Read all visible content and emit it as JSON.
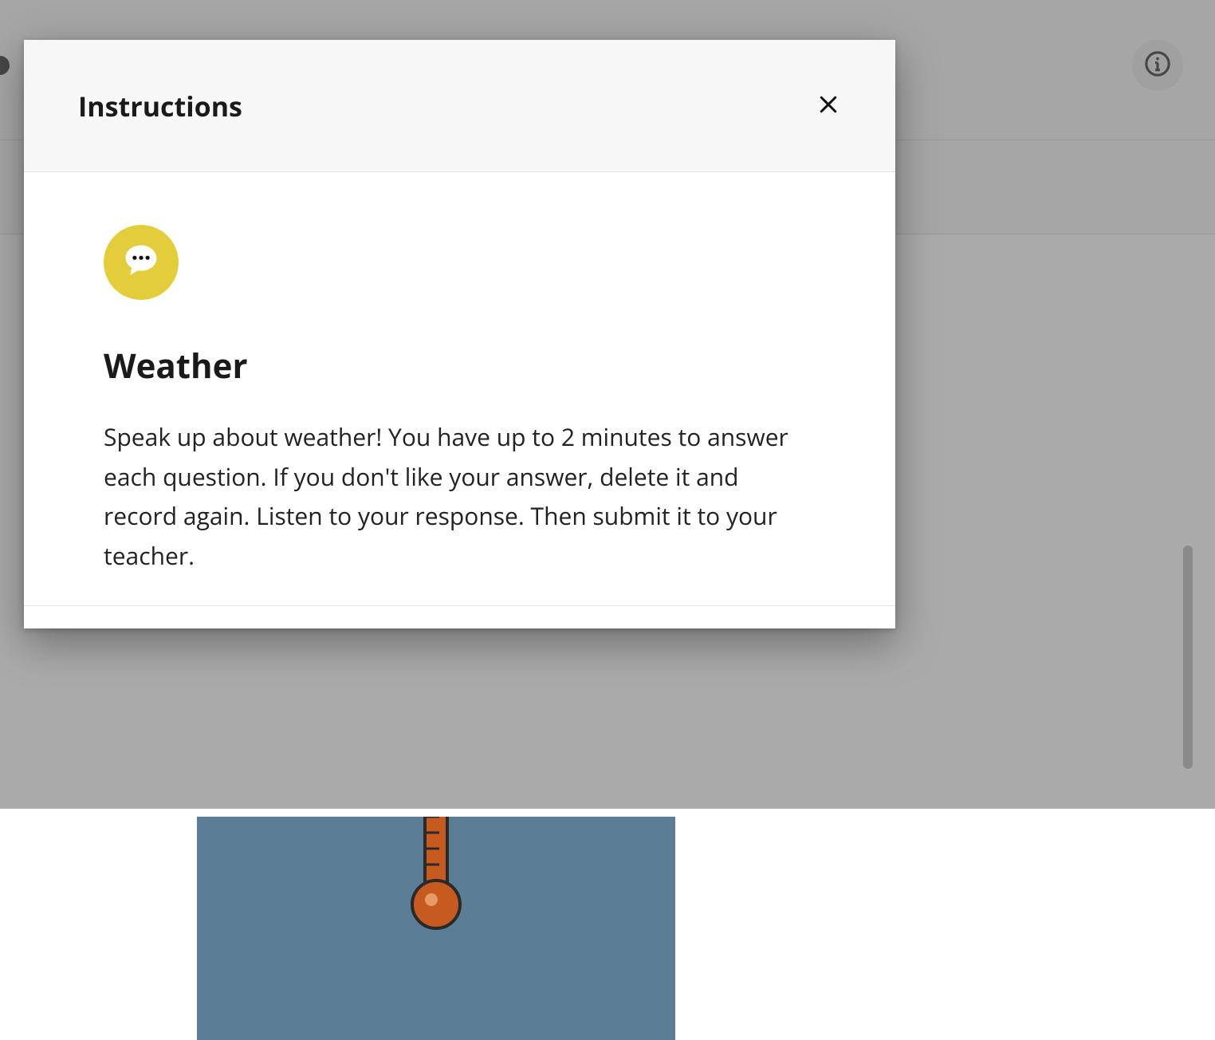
{
  "dialog": {
    "header_title": "Instructions",
    "icon_name": "speech-bubble-icon",
    "body_title": "Weather",
    "body_text": "Speak up about weather! You have up to 2 minutes to answer each question. If you don't like your answer, delete it and record again. Listen to your response. Then submit it to your teacher."
  },
  "toolbar": {
    "info_icon": "info-icon"
  }
}
